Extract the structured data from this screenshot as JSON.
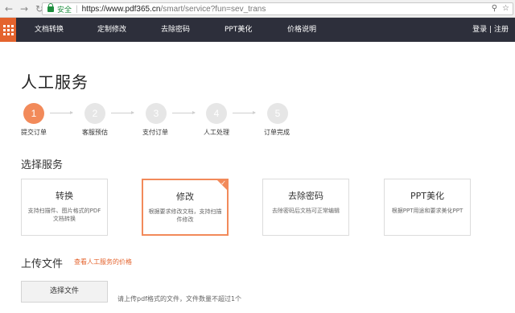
{
  "browser": {
    "back_icon": "arrow-left-icon",
    "forward_icon": "arrow-right-icon",
    "reload_icon": "reload-icon",
    "secure_label": "安全",
    "url_host": "https://www.pdf365.cn",
    "url_path": "/smart/service?fun=sev_trans",
    "search_icon": "magnifier-icon",
    "star_icon": "star-icon"
  },
  "nav": {
    "items": [
      "文档转换",
      "定制修改",
      "去除密码",
      "PPT美化",
      "价格说明"
    ],
    "login": "登录",
    "divider": "|",
    "register": "注册",
    "accent": "#e4632d",
    "background": "#2d2f3b"
  },
  "page": {
    "title": "人工服务",
    "steps": [
      {
        "num": "1",
        "label": "提交订单",
        "active": true
      },
      {
        "num": "2",
        "label": "客服预估",
        "active": false
      },
      {
        "num": "3",
        "label": "支付订单",
        "active": false
      },
      {
        "num": "4",
        "label": "人工处理",
        "active": false
      },
      {
        "num": "5",
        "label": "订单完成",
        "active": false
      }
    ],
    "select_title": "选择服务",
    "services": [
      {
        "title": "转换",
        "desc": "支持扫描件、图片格式的PDF文档转换",
        "selected": false
      },
      {
        "title": "修改",
        "desc": "根据要求修改文档，支持扫描件修改",
        "selected": true
      },
      {
        "title": "去除密码",
        "desc": "去除密码后文档可正常编辑",
        "selected": false
      },
      {
        "title": "PPT美化",
        "desc": "根据PPT用途和要求美化PPT",
        "selected": false
      }
    ],
    "upload_title": "上传文件",
    "upload_link": "查看人工服务的价格",
    "choose_button": "选择文件",
    "hint": "请上传pdf格式的文件，文件数量不超过1个",
    "selected_color": "#f28a5a"
  }
}
